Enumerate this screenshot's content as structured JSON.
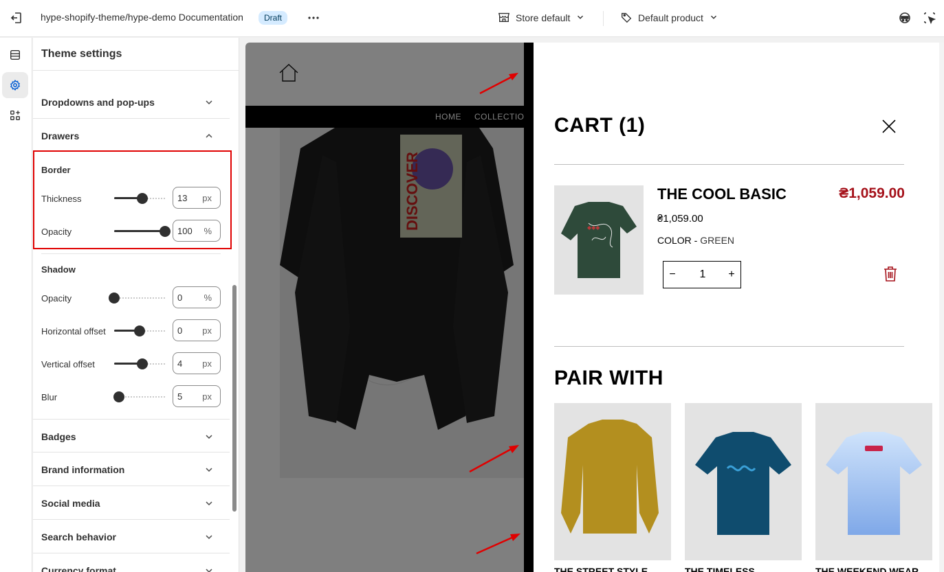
{
  "topbar": {
    "title": "hype-shopify-theme/hype-demo Documentation",
    "status_badge": "Draft",
    "store_selector": "Store default",
    "product_selector": "Default product"
  },
  "sidebar": {
    "title": "Theme settings",
    "sections": [
      {
        "label": "Dropdowns and pop-ups",
        "expanded": false
      },
      {
        "label": "Drawers",
        "expanded": true
      },
      {
        "label": "Badges",
        "expanded": false
      },
      {
        "label": "Brand information",
        "expanded": false
      },
      {
        "label": "Social media",
        "expanded": false
      },
      {
        "label": "Search behavior",
        "expanded": false
      },
      {
        "label": "Currency format",
        "expanded": false
      }
    ],
    "border": {
      "heading": "Border",
      "thickness": {
        "label": "Thickness",
        "value": "13",
        "unit": "px",
        "level": 0.55
      },
      "opacity": {
        "label": "Opacity",
        "value": "100",
        "unit": "%",
        "level": 1.0
      }
    },
    "shadow": {
      "heading": "Shadow",
      "opacity": {
        "label": "Opacity",
        "value": "0",
        "unit": "%",
        "level": 0.0
      },
      "horizontal_offset": {
        "label": "Horizontal offset",
        "value": "0",
        "unit": "px",
        "level": 0.5
      },
      "vertical_offset": {
        "label": "Vertical offset",
        "value": "4",
        "unit": "px",
        "level": 0.55
      },
      "blur": {
        "label": "Blur",
        "value": "5",
        "unit": "px",
        "level": 0.1
      }
    }
  },
  "preview": {
    "nav": [
      "HOME",
      "COLLECTION"
    ],
    "cart": {
      "title": "CART",
      "count": "(1)",
      "item": {
        "name": "THE COOL BASIC",
        "price": "₴1,059.00",
        "total": "₴1,059.00",
        "option_label": "COLOR -",
        "option_value": "GREEN",
        "quantity": "1"
      },
      "pair_with_title": "PAIR WITH",
      "recommendations": [
        {
          "name": "THE STREET STYLE"
        },
        {
          "name": "THE TIMELESS"
        },
        {
          "name": "THE WEEKEND WEAR"
        }
      ]
    }
  },
  "colors": {
    "accent_red": "#e00000",
    "price_red": "#a5111a",
    "draft_badge": "#d5ebff"
  }
}
